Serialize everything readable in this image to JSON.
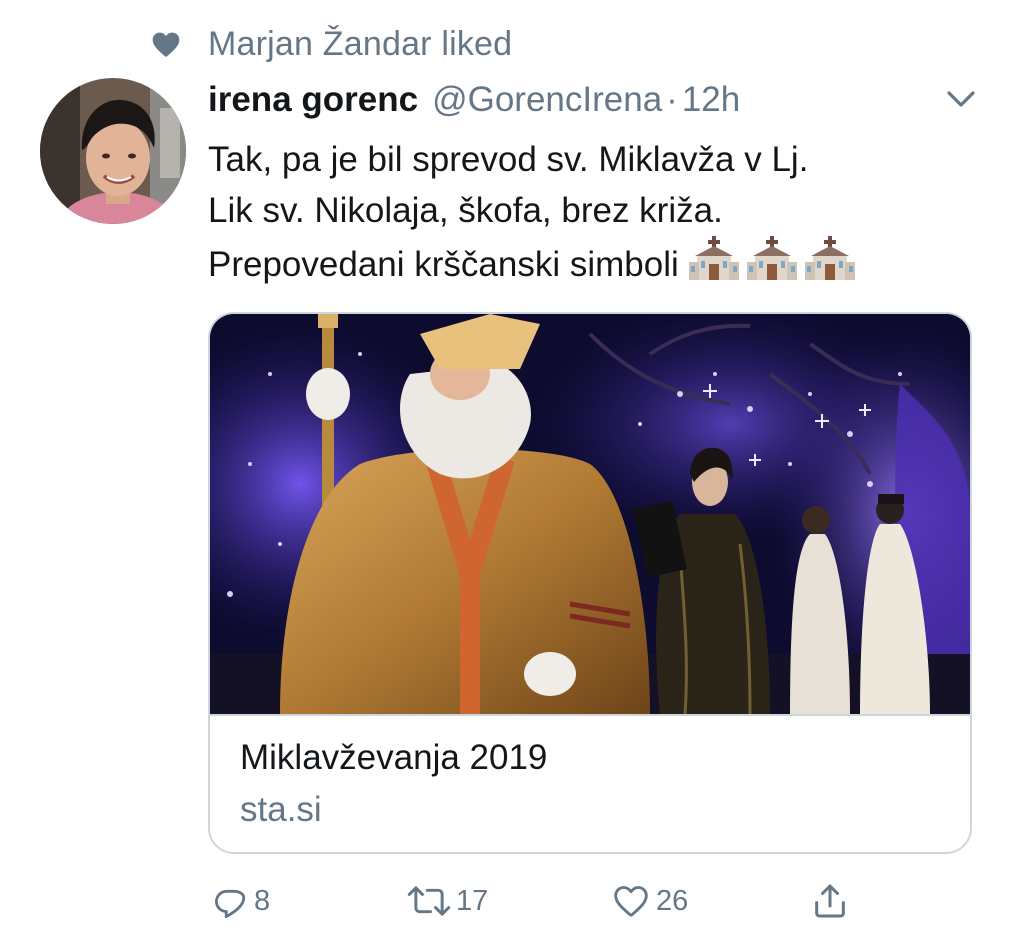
{
  "social_context": {
    "icon": "heart-icon",
    "text": "Marjan Žandar liked"
  },
  "tweet": {
    "author": {
      "display_name": "irena gorenc",
      "handle": "@GorencIrena",
      "avatar_icon": "profile-photo"
    },
    "separator": "·",
    "time": "12h",
    "menu_icon": "chevron-down-icon",
    "text_lines": [
      "Tak, pa je bil sprevod sv. Miklavža v Lj.",
      "Lik sv. Nikolaja, škofa, brez križa.",
      "Prepovedani krščanski simboli"
    ],
    "emoji": [
      "church-emoji",
      "church-emoji",
      "church-emoji"
    ]
  },
  "link_card": {
    "image_icon": "st-nicholas-procession-photo",
    "title": "Miklavževanja 2019",
    "domain": "sta.si"
  },
  "actions": {
    "reply": {
      "icon": "reply-icon",
      "count": "8"
    },
    "retweet": {
      "icon": "retweet-icon",
      "count": "17"
    },
    "like": {
      "icon": "heart-outline-icon",
      "count": "26"
    },
    "share": {
      "icon": "share-icon"
    }
  },
  "colors": {
    "text_primary": "#14171a",
    "text_secondary": "#657786",
    "border": "#ccd6dd",
    "context_icon": "#657786"
  }
}
